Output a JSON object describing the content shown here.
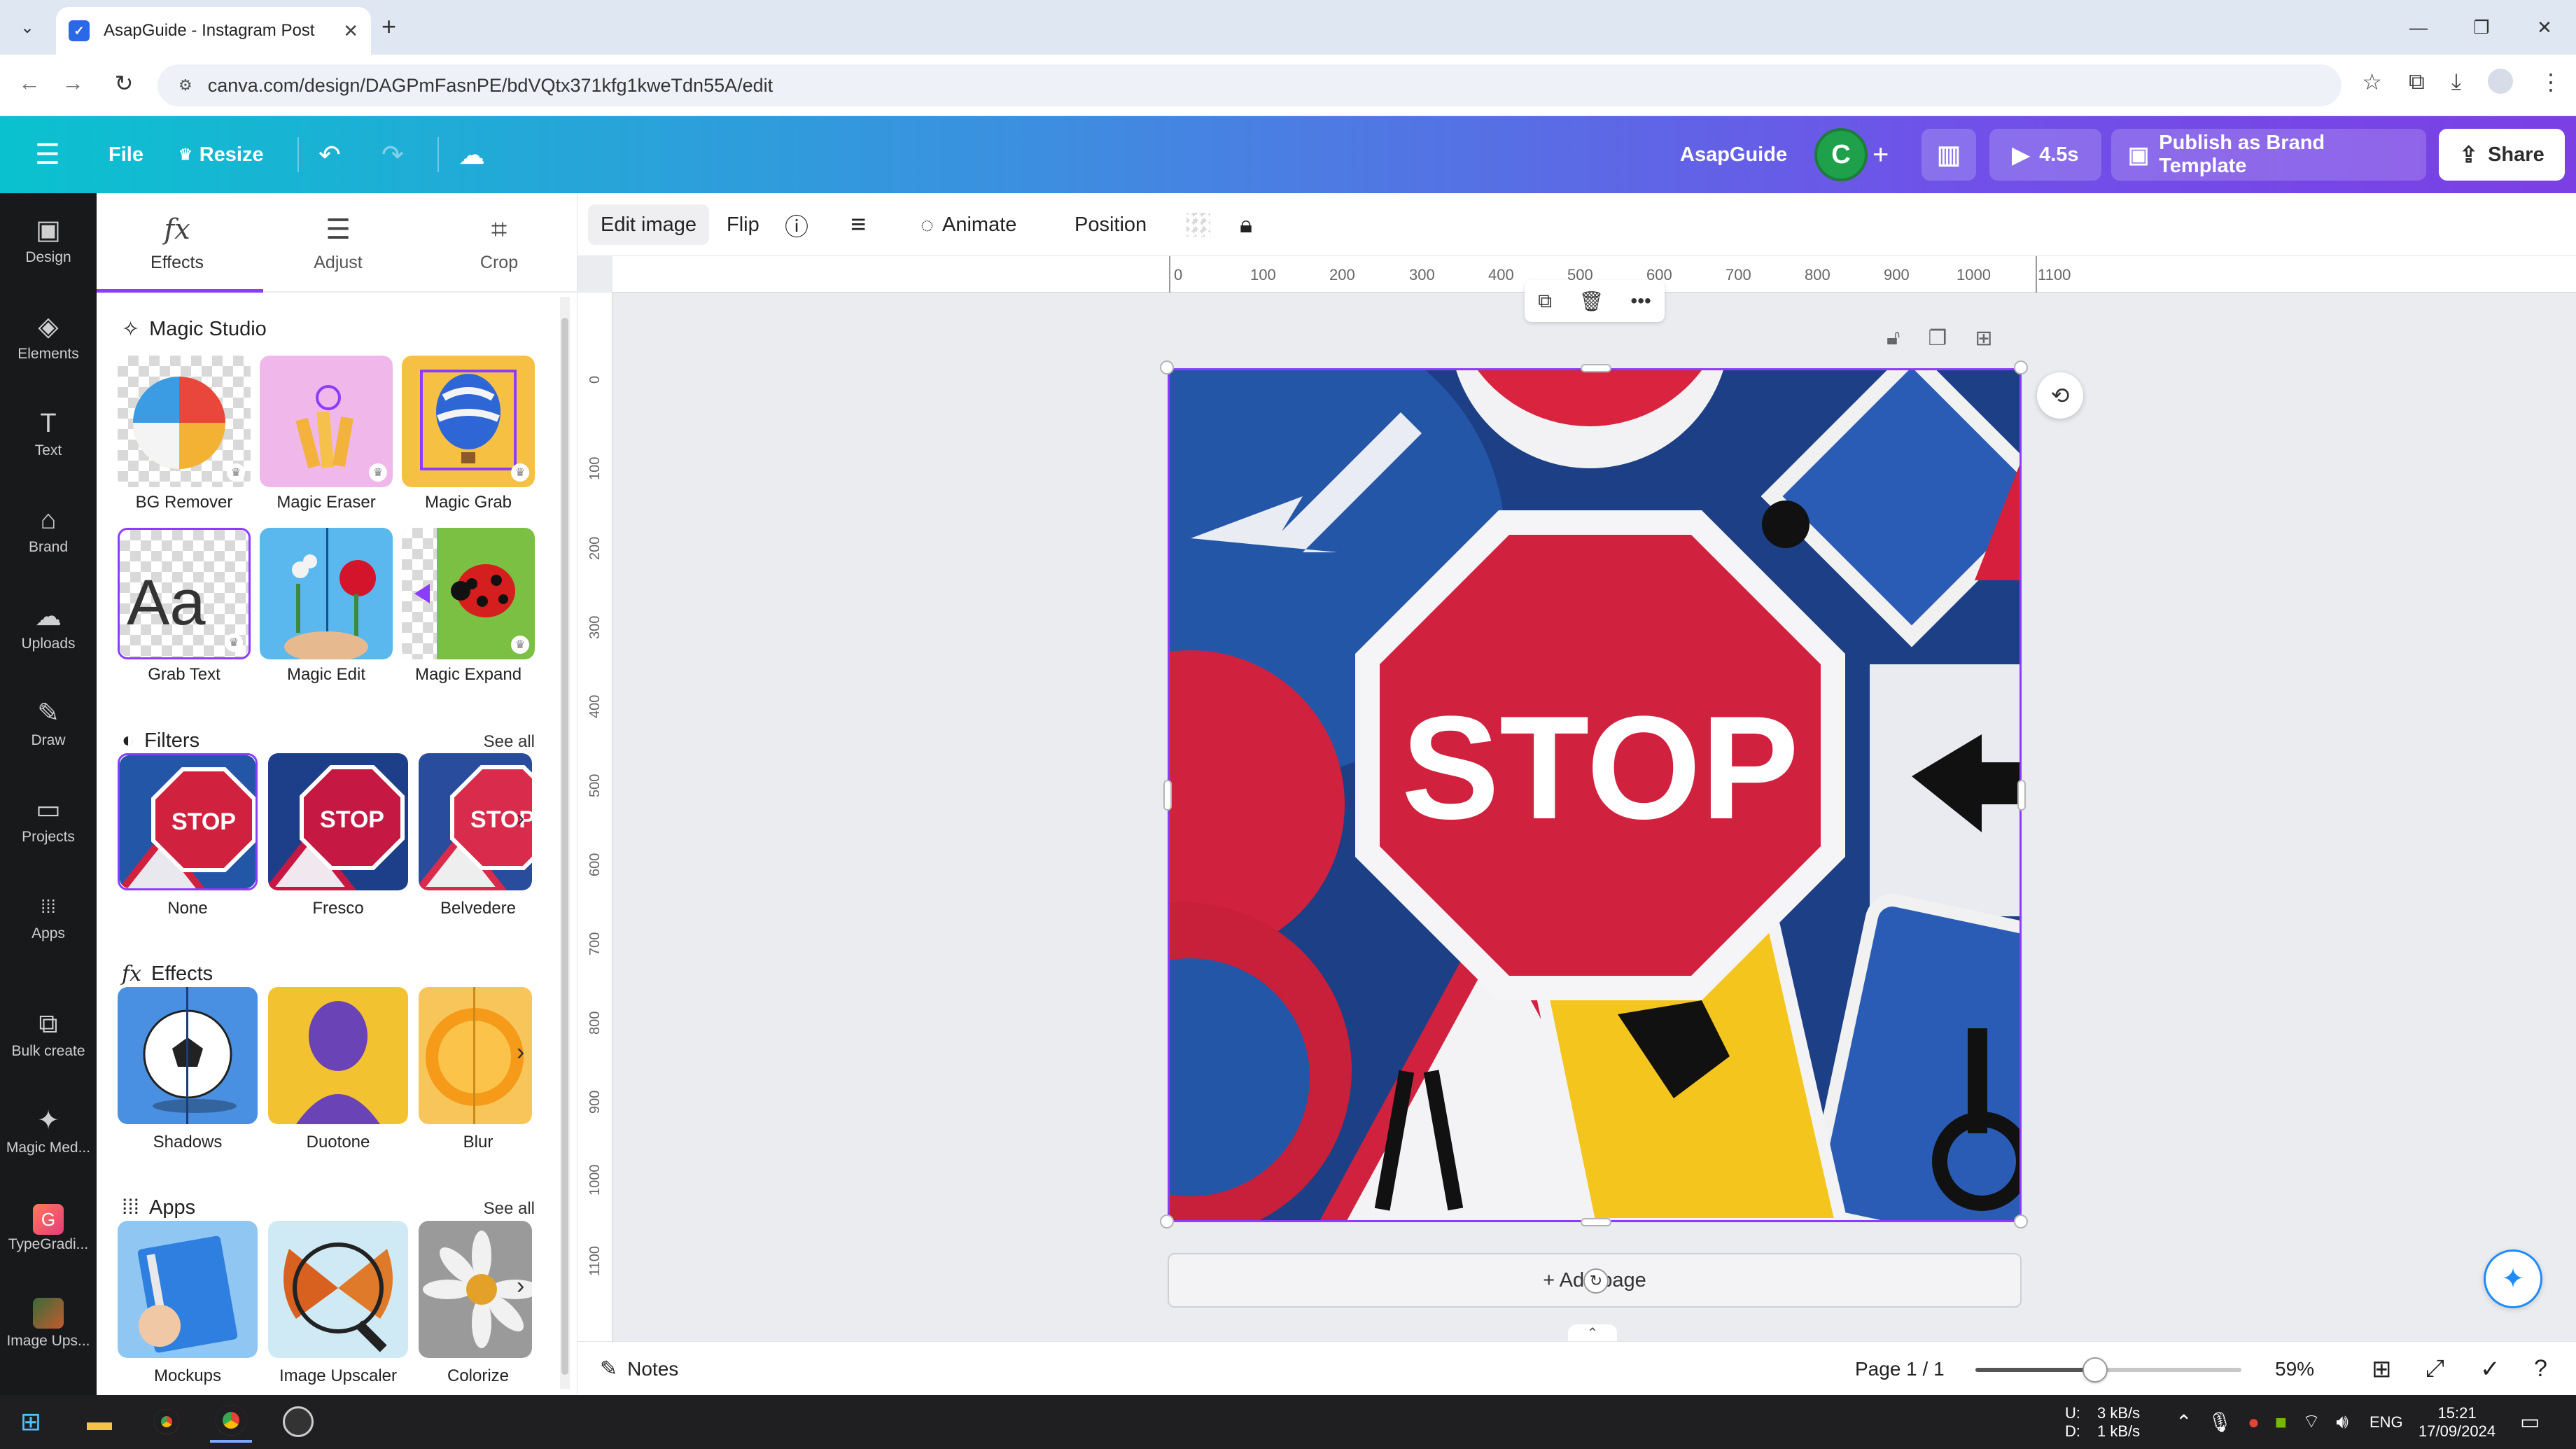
{
  "browser": {
    "tab_title": "AsapGuide - Instagram Post",
    "url": "canva.com/design/DAGPmFasnPE/bdVQtx371kfg1kweTdn55A/edit",
    "tab_dropdown_icon": "chevron-down-icon",
    "new_tab_symbol": "+",
    "close_symbol": "✕",
    "window_controls": [
      "—",
      "❐",
      "✕"
    ]
  },
  "header": {
    "file_label": "File",
    "resize_label": "Resize",
    "team_name": "AsapGuide",
    "avatar_letter": "C",
    "add_symbol": "+",
    "play_time": "4.5s",
    "publish_label": "Publish as Brand Template",
    "share_label": "Share"
  },
  "rail": {
    "items": [
      {
        "label": "Design",
        "icon": "▣"
      },
      {
        "label": "Elements",
        "icon": "◈"
      },
      {
        "label": "Text",
        "icon": "T"
      },
      {
        "label": "Brand",
        "icon": "⌂"
      },
      {
        "label": "Uploads",
        "icon": "☁"
      },
      {
        "label": "Draw",
        "icon": "✎"
      },
      {
        "label": "Projects",
        "icon": "▭"
      },
      {
        "label": "Apps",
        "icon": "⁞⁞⁞"
      },
      {
        "label": "Bulk create",
        "icon": "⧉"
      },
      {
        "label": "Magic Med...",
        "icon": "✦"
      },
      {
        "label": "TypeGradi...",
        "icon": "G"
      },
      {
        "label": "Image Ups...",
        "icon": "▲"
      }
    ]
  },
  "panel": {
    "tabs": [
      {
        "label": "Effects",
        "icon": "fx"
      },
      {
        "label": "Adjust",
        "icon": "☰"
      },
      {
        "label": "Crop",
        "icon": "⌗"
      }
    ],
    "magic_studio": {
      "title": "Magic Studio",
      "tools": [
        "BG Remover",
        "Magic Eraser",
        "Magic Grab",
        "Grab Text",
        "Magic Edit",
        "Magic Expand"
      ],
      "grab_text_sample": "Aa"
    },
    "filters": {
      "title": "Filters",
      "see_all": "See all",
      "items": [
        "None",
        "Fresco",
        "Belvedere"
      ],
      "thumb_text": "STOP"
    },
    "effects": {
      "title": "Effects",
      "items": [
        "Shadows",
        "Duotone",
        "Blur"
      ]
    },
    "apps": {
      "title": "Apps",
      "see_all": "See all",
      "items": [
        "Mockups",
        "Image Upscaler",
        "Colorize"
      ]
    }
  },
  "context_toolbar": {
    "edit_image": "Edit image",
    "flip": "Flip",
    "animate": "Animate",
    "position": "Position"
  },
  "ruler": {
    "top_ticks": [
      "0",
      "100",
      "200",
      "300",
      "400",
      "500",
      "600",
      "700",
      "800",
      "900",
      "1000",
      "1100"
    ],
    "left_ticks": [
      "0",
      "100",
      "200",
      "300",
      "400",
      "500",
      "600",
      "700",
      "800",
      "900",
      "1000",
      "1100"
    ]
  },
  "canvas": {
    "sign_text": "STOP",
    "add_page_label": "+ Add page"
  },
  "footer": {
    "notes_label": "Notes",
    "page_indicator": "Page 1 / 1",
    "zoom_level": "59%",
    "zoom_fraction": 0.45
  },
  "taskbar": {
    "net_up": "3 kB/s",
    "net_down": "1 kB/s",
    "net_labels": [
      "U:",
      "D:"
    ],
    "language": "ENG",
    "time": "15:21",
    "date": "17/09/2024"
  },
  "colors": {
    "accent": "#8b3dff",
    "header_start": "#0ac2cf",
    "header_end": "#7b3fe4",
    "stop_red": "#d0223f",
    "sign_blue": "#2456a8"
  }
}
